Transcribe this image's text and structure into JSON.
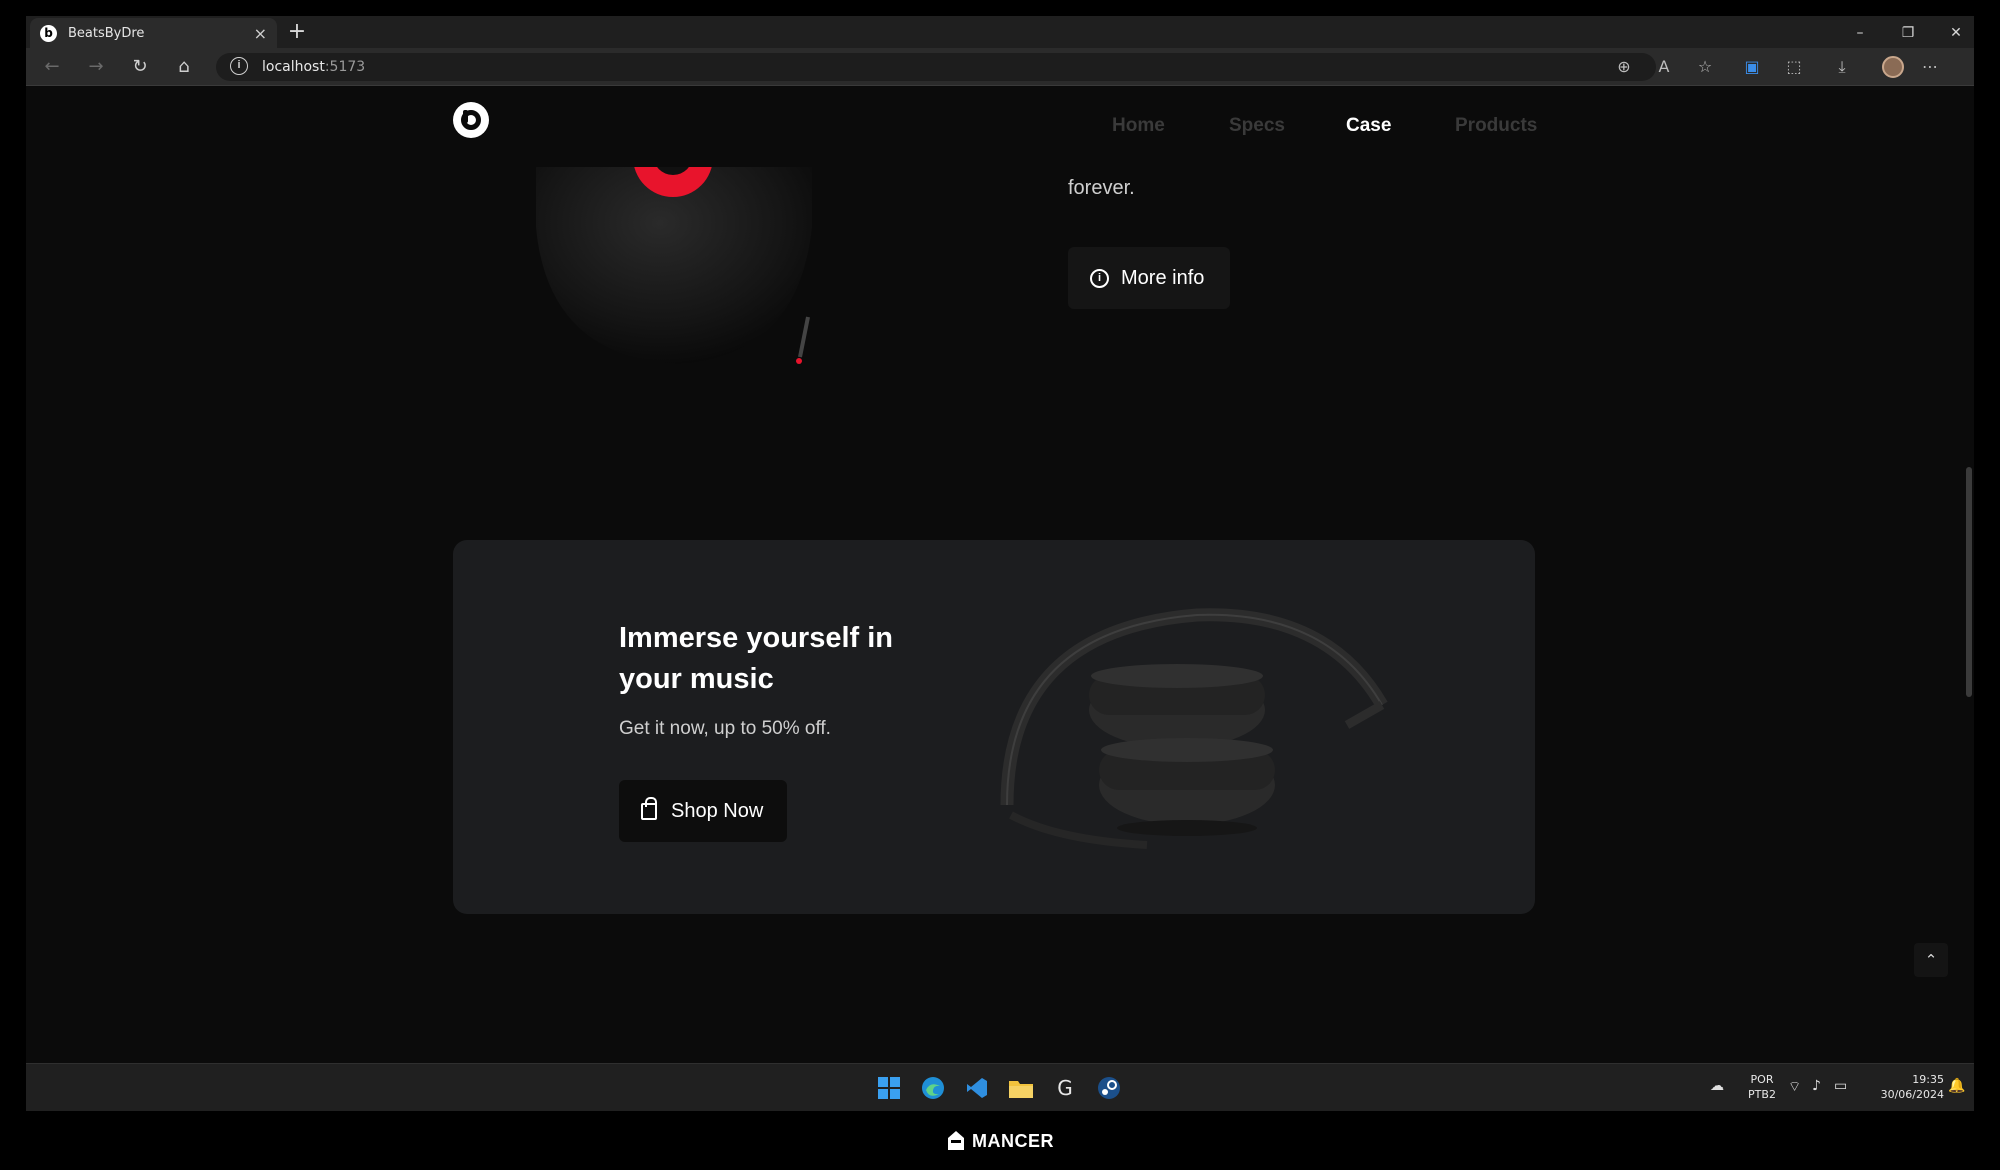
{
  "browser": {
    "tab_title": "BeatsByDre",
    "url_host": "localhost",
    "url_port": ":5173",
    "favicon_letter": "b"
  },
  "site": {
    "nav": [
      "Home",
      "Specs",
      "Case",
      "Products"
    ],
    "active_nav": "Case",
    "body_tail": "forever.",
    "more_info_label": "More info",
    "promo": {
      "title": "Immerse yourself in your music",
      "subtitle": "Get it now, up to 50% off.",
      "button_label": "Shop Now"
    },
    "brand_red": "#e8142c"
  },
  "taskbar": {
    "lang_top": "POR",
    "lang_bottom": "PTB2",
    "time": "19:35",
    "date": "30/06/2024"
  },
  "footer_brand": "MANCER"
}
